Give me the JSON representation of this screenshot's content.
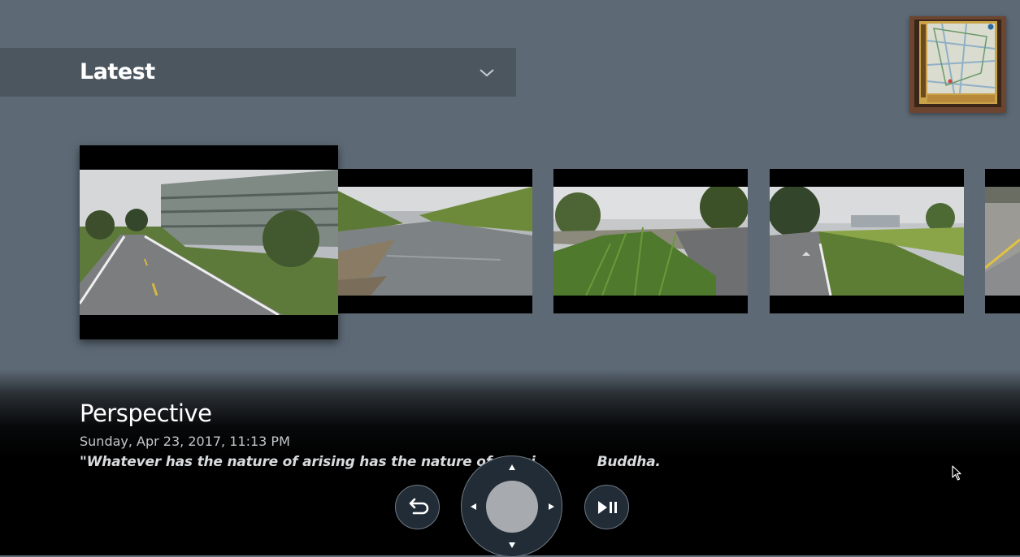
{
  "filter": {
    "selected": "Latest",
    "chevron_icon": "chevron-down-icon"
  },
  "profile": {
    "icon": "profile-photo-thumbnail"
  },
  "carousel": {
    "items": [
      {
        "scene": "road-and-parking-garage",
        "focused": true
      },
      {
        "scene": "creek-water",
        "focused": false
      },
      {
        "scene": "grass-by-canal",
        "focused": false
      },
      {
        "scene": "bike-path-grass",
        "focused": false
      },
      {
        "scene": "wall-and-path",
        "focused": false
      }
    ]
  },
  "info": {
    "title": "Perspective",
    "date": "Sunday, Apr 23, 2017, 11:13 PM",
    "quote": "\"Whatever has the nature of arising has the nature of ceasi",
    "quote_tail": "Buddha."
  },
  "remote": {
    "back_icon": "back-arrow-icon",
    "play_pause_icon": "play-pause-icon",
    "dpad_icons": [
      "up-arrow-icon",
      "down-arrow-icon",
      "left-arrow-icon",
      "right-arrow-icon"
    ]
  },
  "colors": {
    "background": "#5d6975",
    "dropdown_bar": "#4b565f",
    "control_fill": "#222c36",
    "dpad_center": "#a7abaf"
  }
}
